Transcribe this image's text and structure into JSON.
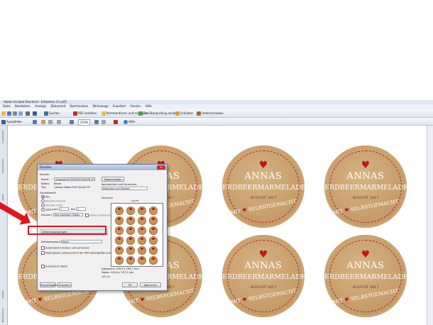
{
  "window": {
    "title": "Adobe Acrobat Standard - [etiketten (1).pdf]"
  },
  "menu": [
    "Datei",
    "Bearbeiten",
    "Anzeige",
    "Dokument",
    "Kommentare",
    "Werkzeuge",
    "Erweitert",
    "Fenster",
    "Hilfe"
  ],
  "toolbar": {
    "items": [
      "Suchen",
      "PDF erstellen",
      "Kommentieren und markieren",
      "Zur Überprüfung senden",
      "Schützen",
      "Unterschreiben"
    ],
    "select_label": "Auswählen",
    "zoom": "219%",
    "help": "Hilfe"
  },
  "left_panel": {
    "tabs": [
      "Lesezeichen",
      "Unterschriften",
      "Seiten",
      "Anlagen",
      "Kommentare"
    ]
  },
  "labels": {
    "line1": "ANNAS",
    "line2": "ERDBEERMARMELADE",
    "line3": "AUGUST 2017",
    "line4a": "MIT",
    "line4b": "SELBSTGEMACHT",
    "count": 8
  },
  "dialog": {
    "title": "Drucken",
    "printer_heading": "Drucker",
    "name_label": "Name:",
    "name_value": "\\\\Hajpdata01\\PHOKOS31EXLEN (E)",
    "status_label": "Status:",
    "status_value": "Bereit",
    "type_label": "Typ:",
    "type_value": "\\\\Xerox Global Print Driver PS",
    "properties_button": "Eigenschaften",
    "comments_label": "Kommentare und Formulare:",
    "comments_value": "Dokument und Stempel",
    "range_heading": "Druckbereich",
    "range_all": "Alle",
    "range_current_view": "Aktuelle Ansicht",
    "range_current_page": "Aktuelle Seite",
    "range_pages": "Seiten",
    "from_label": "von:",
    "from_value": "1",
    "to_label": "bis:",
    "to_value": "1",
    "subset_label": "Drucken:",
    "subset_value": "Alle ungerade / Seiten",
    "reverse_label": "Seiten umkehren",
    "page_setup_bar": "Seitenanpassungen",
    "scaling_label": "Seitenanpassung:",
    "scaling_value": "Keine",
    "auto_rotate": "Automatisch drehen und zentrieren",
    "pdf_pagesize": "Papierquelle entsprechend der PDF-Seitengröße auswählen",
    "print_to_file": "Ausdruck in Datei",
    "preview_label": "Vorschau",
    "preview_width": "209,55",
    "preview_height": "297,00",
    "doc_size": "Dokument: 209,9 x 296,7 mm",
    "paper_size": "Papier: 209,9 x 297,0 mm",
    "page_count": "1/1 (1)",
    "tips_button": "Druckfreigabe",
    "advanced_button": "Erweitert",
    "ok_button": "OK",
    "cancel_button": "Abbrechen"
  }
}
